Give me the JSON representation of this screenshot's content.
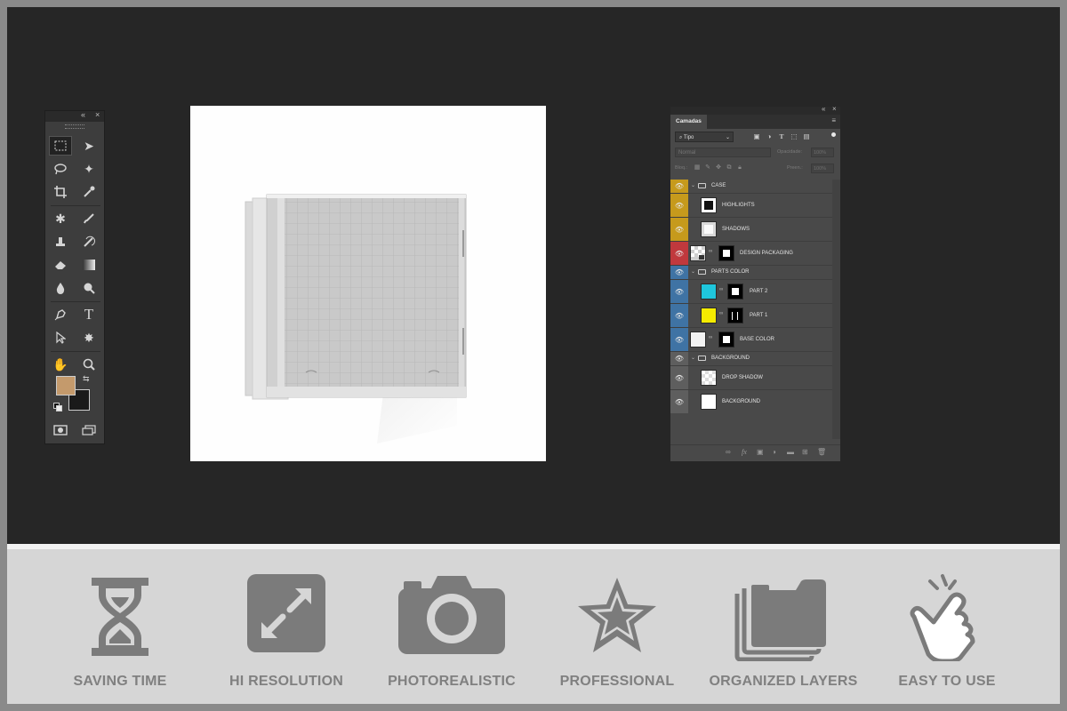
{
  "layers_panel": {
    "tab_label": "Camadas",
    "search_placeholder": "Tipo",
    "blend_mode": "Normal",
    "opacity_label": "Opacidade:",
    "opacity_value": "100%",
    "lock_label": "Bloq.:",
    "fill_label": "Preen.:",
    "fill_value": "100%",
    "layers": [
      {
        "name": "CASE",
        "kind": "group",
        "color": "#c69a1c"
      },
      {
        "name": "HIGHLIGHTS",
        "kind": "layer",
        "color": "#c69a1c"
      },
      {
        "name": "SHADOWS",
        "kind": "layer",
        "color": "#c69a1c"
      },
      {
        "name": "DESIGN PACKAGING",
        "kind": "smart",
        "color": "#c0393d"
      },
      {
        "name": "PARTS COLOR",
        "kind": "group",
        "color": "#3f73a4"
      },
      {
        "name": "PART 2",
        "kind": "fill",
        "color": "#3f73a4",
        "swatch": "#1fc6dc"
      },
      {
        "name": "PART 1",
        "kind": "fill",
        "color": "#3f73a4",
        "swatch": "#f5ec00"
      },
      {
        "name": "BASE COLOR",
        "kind": "fill",
        "color": "#3f73a4",
        "swatch": "#f2f2f2"
      },
      {
        "name": "BACKGROUND",
        "kind": "group",
        "color": "#5e5e5e"
      },
      {
        "name": "DROP SHADOW",
        "kind": "layer",
        "color": "#5e5e5e"
      },
      {
        "name": "BACKGROUND",
        "kind": "fill",
        "color": "#5e5e5e"
      }
    ]
  },
  "tools_panel": {
    "foreground_color": "#c49a6c",
    "background_color": "#1a1a1a"
  },
  "features": [
    {
      "label": "SAVING TIME",
      "icon": "hourglass-icon"
    },
    {
      "label": "HI RESOLUTION",
      "icon": "expand-icon"
    },
    {
      "label": "PHOTOREALISTIC",
      "icon": "camera-icon"
    },
    {
      "label": "PROFESSIONAL",
      "icon": "star-icon"
    },
    {
      "label": "ORGANIZED LAYERS",
      "icon": "layers-icon"
    },
    {
      "label": "EASY TO USE",
      "icon": "pointer-hand-icon"
    }
  ]
}
